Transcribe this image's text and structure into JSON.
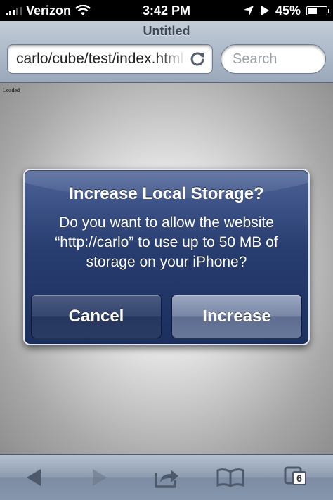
{
  "status_bar": {
    "carrier": "Verizon",
    "time": "3:42 PM",
    "battery": "45%",
    "battery_level": 0.45
  },
  "browser": {
    "title": "Untitled",
    "url": "carlo/cube/test/index.html",
    "search_placeholder": "Search"
  },
  "page": {
    "status_text": "Loaded"
  },
  "alert": {
    "title": "Increase Local Storage?",
    "message": "Do you want to allow the website “http://carlo” to use up to 50 MB of storage on your iPhone?",
    "cancel_label": "Cancel",
    "confirm_label": "Increase"
  },
  "toolbar": {
    "pages_count": "6",
    "icons": [
      "back-arrow-icon",
      "forward-arrow-icon",
      "share-icon",
      "bookmarks-icon",
      "pages-icon"
    ]
  },
  "colors": {
    "alert_bg": "#283d70",
    "toolbar_bg": "#8d9bb0",
    "header_bg": "#aab6c6"
  }
}
